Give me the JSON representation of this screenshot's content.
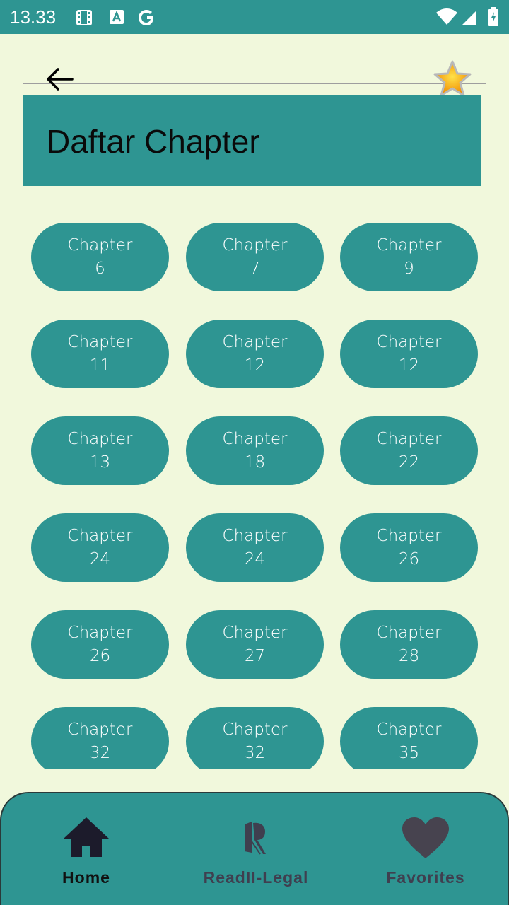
{
  "status_bar": {
    "time": "13.33",
    "icons": [
      "film-icon",
      "accessibility-a-icon",
      "google-g-icon",
      "wifi-icon",
      "signal-icon",
      "battery-icon"
    ]
  },
  "header": {
    "back_icon": "arrow-left-icon",
    "favorite_icon": "star-icon"
  },
  "title": "Daftar Chapter",
  "chapter_label": "Chapter",
  "chapters": [
    "6",
    "7",
    "9",
    "11",
    "12",
    "12",
    "13",
    "18",
    "22",
    "24",
    "24",
    "26",
    "26",
    "27",
    "28",
    "32",
    "32",
    "35"
  ],
  "bottom_nav": {
    "items": [
      {
        "label": "Home",
        "icon": "home-icon",
        "active": true
      },
      {
        "label": "ReadII-Legal",
        "icon": "readii-logo-icon",
        "active": false
      },
      {
        "label": "Favorites",
        "icon": "heart-icon",
        "active": false
      }
    ]
  },
  "colors": {
    "background": "#f1f8dc",
    "accent": "#2e9592",
    "active_nav": "#111111",
    "inactive_nav": "#3f3f4f"
  }
}
